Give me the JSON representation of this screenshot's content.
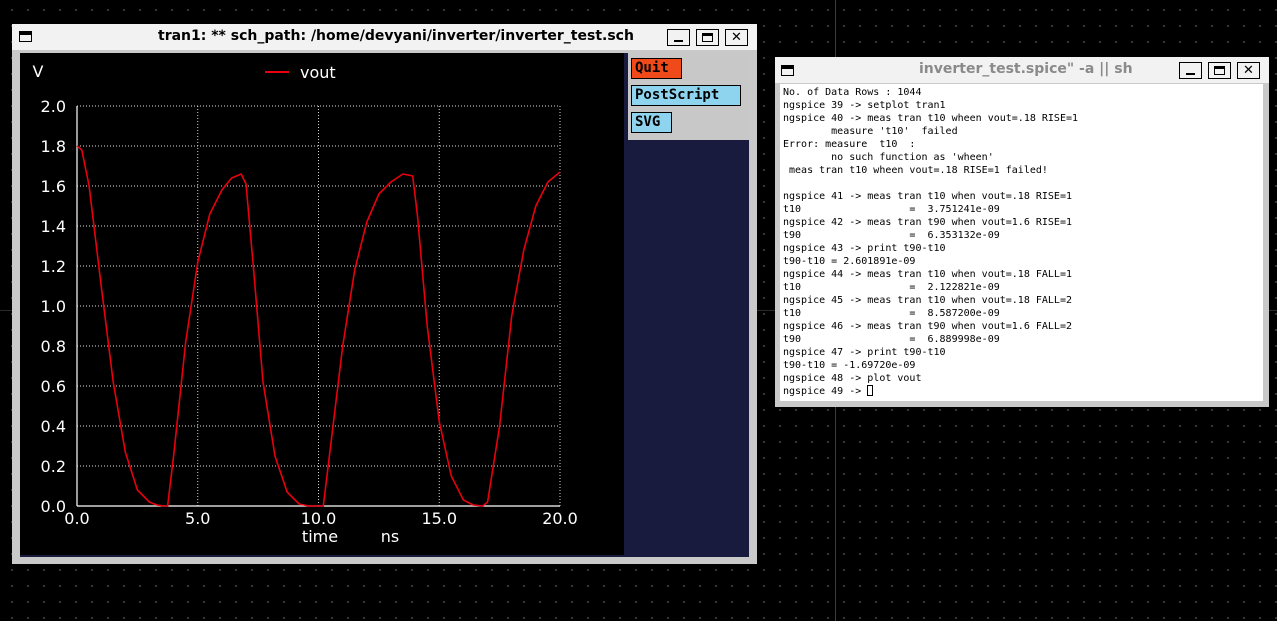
{
  "plot_window": {
    "title": "tran1: ** sch_path: /home/devyani/inverter/inverter_test.sch",
    "buttons": {
      "quit": "Quit",
      "postscript": "PostScript",
      "svg": "SVG"
    },
    "colors": {
      "quit_bg": "#f04a1a",
      "btn_bg": "#8fd4ef",
      "trace": "#e8000e",
      "grid": "#d8d8d8"
    }
  },
  "chart_data": {
    "type": "line",
    "ylabel": "V",
    "xlabel": "time",
    "xunit": "ns",
    "xlim": [
      0,
      20
    ],
    "ylim": [
      0,
      2
    ],
    "xticks": [
      "0.0",
      "5.0",
      "10.0",
      "15.0",
      "20.0"
    ],
    "yticks": [
      "0.0",
      "0.2",
      "0.4",
      "0.6",
      "0.8",
      "1.0",
      "1.2",
      "1.4",
      "1.6",
      "1.8",
      "2.0"
    ],
    "grid": true,
    "legend_placement": "top-center",
    "series": [
      {
        "name": "vout",
        "x": [
          0,
          0.2,
          0.5,
          1.0,
          1.5,
          2.0,
          2.5,
          3.0,
          3.3,
          3.6,
          3.75,
          4.0,
          4.5,
          5.0,
          5.5,
          6.0,
          6.4,
          6.8,
          7.0,
          7.3,
          7.7,
          8.2,
          8.7,
          9.2,
          9.6,
          10.0,
          10.2,
          10.5,
          11.0,
          11.5,
          12.0,
          12.5,
          13.0,
          13.5,
          13.9,
          14.1,
          14.5,
          15.0,
          15.5,
          16.0,
          16.4,
          16.8,
          17.0,
          17.5,
          18.0,
          18.5,
          19.0,
          19.5,
          20.0
        ],
        "y": [
          1.8,
          1.78,
          1.6,
          1.1,
          0.62,
          0.27,
          0.08,
          0.02,
          0.005,
          0.0,
          0.0,
          0.25,
          0.82,
          1.22,
          1.46,
          1.58,
          1.64,
          1.66,
          1.61,
          1.2,
          0.62,
          0.25,
          0.07,
          0.01,
          0.0,
          0.0,
          0.0,
          0.3,
          0.8,
          1.18,
          1.42,
          1.56,
          1.62,
          1.66,
          1.65,
          1.45,
          0.9,
          0.42,
          0.15,
          0.03,
          0.005,
          0.0,
          0.02,
          0.4,
          0.95,
          1.28,
          1.5,
          1.62,
          1.67
        ]
      }
    ]
  },
  "terminal_window": {
    "title": "inverter_test.spice\" -a || sh",
    "lines": [
      "No. of Data Rows : 1044",
      "ngspice 39 -> setplot tran1",
      "ngspice 40 -> meas tran t10 wheen vout=.18 RISE=1",
      "        measure 't10'  failed",
      "Error: measure  t10  :",
      "        no such function as 'wheen'",
      " meas tran t10 wheen vout=.18 RISE=1 failed!",
      "",
      "ngspice 41 -> meas tran t10 when vout=.18 RISE=1",
      "t10                  =  3.751241e-09",
      "ngspice 42 -> meas tran t90 when vout=1.6 RISE=1",
      "t90                  =  6.353132e-09",
      "ngspice 43 -> print t90-t10",
      "t90-t10 = 2.601891e-09",
      "ngspice 44 -> meas tran t10 when vout=.18 FALL=1",
      "t10                  =  2.122821e-09",
      "ngspice 45 -> meas tran t10 when vout=.18 FALL=2",
      "t10                  =  8.587200e-09",
      "ngspice 46 -> meas tran t90 when vout=1.6 FALL=2",
      "t90                  =  6.889998e-09",
      "ngspice 47 -> print t90-t10",
      "t90-t10 = -1.69720e-09",
      "ngspice 48 -> plot vout"
    ],
    "prompt": "ngspice 49 -> "
  }
}
